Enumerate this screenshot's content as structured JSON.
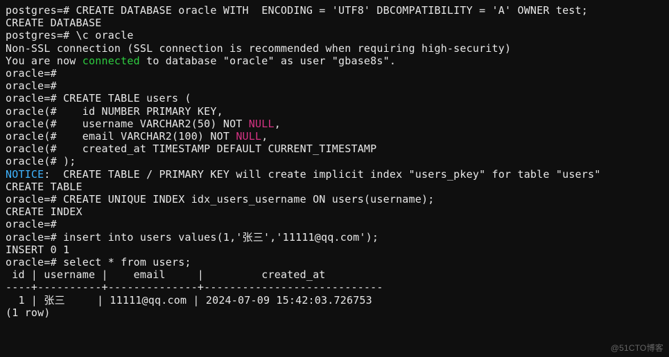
{
  "lines": [
    {
      "segments": [
        {
          "t": "postgres=# CREATE DATABASE oracle WITH  ENCODING = 'UTF8' DBCOMPATIBILITY = 'A' OWNER test;"
        }
      ]
    },
    {
      "segments": [
        {
          "t": "CREATE DATABASE"
        }
      ]
    },
    {
      "segments": [
        {
          "t": "postgres=# \\c oracle"
        }
      ]
    },
    {
      "segments": [
        {
          "t": "Non-SSL connection (SSL connection is recommended when requiring high-security)"
        }
      ]
    },
    {
      "segments": [
        {
          "t": "You are now "
        },
        {
          "t": "connected",
          "cls": "g"
        },
        {
          "t": " to database \"oracle\" as user \"gbase8s\"."
        }
      ]
    },
    {
      "segments": [
        {
          "t": "oracle=#"
        }
      ]
    },
    {
      "segments": [
        {
          "t": "oracle=#"
        }
      ]
    },
    {
      "segments": [
        {
          "t": "oracle=# CREATE TABLE users ("
        }
      ]
    },
    {
      "segments": [
        {
          "t": "oracle(#    id NUMBER PRIMARY KEY,"
        }
      ]
    },
    {
      "segments": [
        {
          "t": "oracle(#    username VARCHAR2(50) NOT "
        },
        {
          "t": "NULL",
          "cls": "m"
        },
        {
          "t": ","
        }
      ]
    },
    {
      "segments": [
        {
          "t": "oracle(#    email VARCHAR2(100) NOT "
        },
        {
          "t": "NULL",
          "cls": "m"
        },
        {
          "t": ","
        }
      ]
    },
    {
      "segments": [
        {
          "t": "oracle(#    created_at TIMESTAMP DEFAULT CURRENT_TIMESTAMP"
        }
      ]
    },
    {
      "segments": [
        {
          "t": "oracle(# );"
        }
      ]
    },
    {
      "segments": [
        {
          "t": "NOTICE",
          "cls": "c"
        },
        {
          "t": ":  CREATE TABLE / PRIMARY KEY will create implicit index \"users_pkey\" for table \"users\""
        }
      ]
    },
    {
      "segments": [
        {
          "t": "CREATE TABLE"
        }
      ]
    },
    {
      "segments": [
        {
          "t": "oracle=# CREATE UNIQUE INDEX idx_users_username ON users(username);"
        }
      ]
    },
    {
      "segments": [
        {
          "t": "CREATE INDEX"
        }
      ]
    },
    {
      "segments": [
        {
          "t": "oracle=#"
        }
      ]
    },
    {
      "segments": [
        {
          "t": "oracle=# insert into users values(1,'张三','11111@qq.com');"
        }
      ]
    },
    {
      "segments": [
        {
          "t": "INSERT 0 1"
        }
      ]
    },
    {
      "segments": [
        {
          "t": "oracle=# select * from users;"
        }
      ]
    },
    {
      "segments": [
        {
          "t": " id | username |    email     |         created_at"
        }
      ]
    },
    {
      "segments": [
        {
          "t": "----+----------+--------------+----------------------------"
        }
      ]
    },
    {
      "segments": [
        {
          "t": "  1 | 张三     | 11111@qq.com | 2024-07-09 15:42:03.726753"
        }
      ]
    },
    {
      "segments": [
        {
          "t": "(1 row)"
        }
      ]
    }
  ],
  "watermark": "@51CTO博客",
  "query_result": {
    "columns": [
      "id",
      "username",
      "email",
      "created_at"
    ],
    "rows": [
      {
        "id": 1,
        "username": "张三",
        "email": "11111@qq.com",
        "created_at": "2024-07-09 15:42:03.726753"
      }
    ],
    "row_count_text": "(1 row)"
  }
}
